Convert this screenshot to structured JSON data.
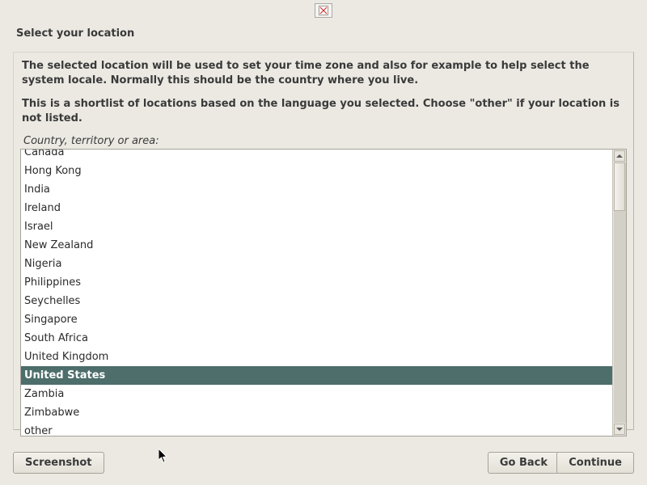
{
  "header": {
    "title": "Select your location"
  },
  "panel": {
    "desc_line1": "The selected location will be used to set your time zone and also for example to help select the system locale. Normally this should be the country where you live.",
    "desc_line2": "This is a shortlist of locations based on the language you selected. Choose \"other\" if your location is not listed.",
    "list_label": "Country, territory or area:"
  },
  "list": {
    "items": [
      "Canada",
      "Hong Kong",
      "India",
      "Ireland",
      "Israel",
      "New Zealand",
      "Nigeria",
      "Philippines",
      "Seychelles",
      "Singapore",
      "South Africa",
      "United Kingdom",
      "United States",
      "Zambia",
      "Zimbabwe",
      "other"
    ],
    "selected_index": 12
  },
  "footer": {
    "screenshot": "Screenshot",
    "goback": "Go Back",
    "continue": "Continue"
  }
}
